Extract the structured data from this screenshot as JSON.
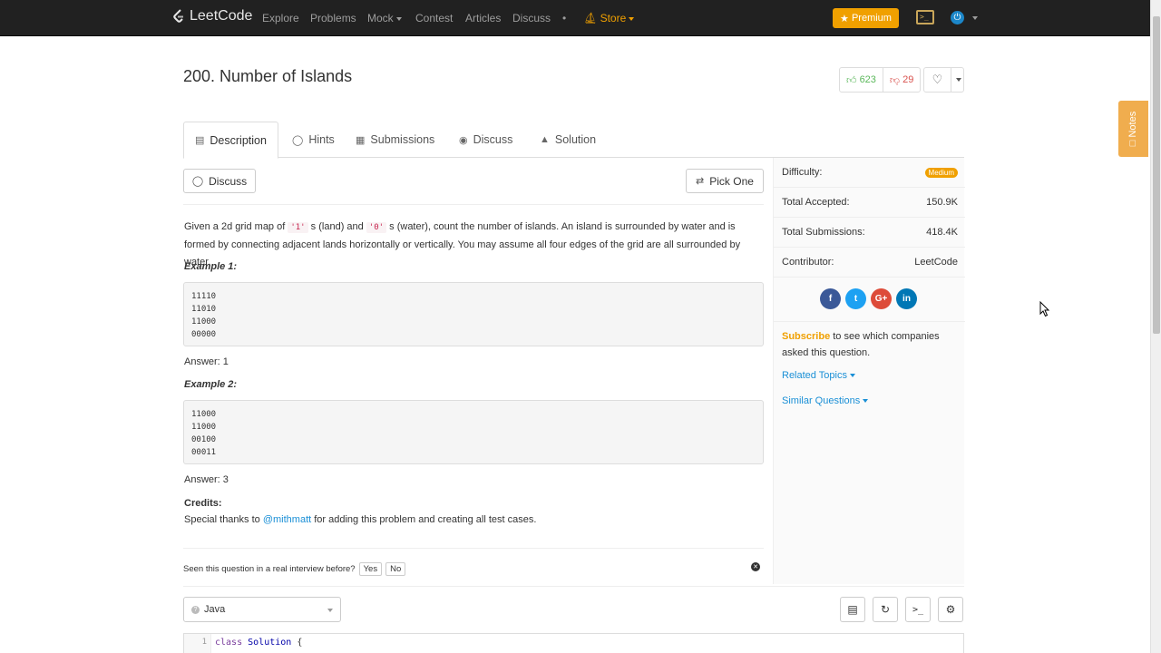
{
  "nav": {
    "logo_text": "LeetCode",
    "links": [
      "Explore",
      "Problems",
      "Mock",
      "Contest",
      "Articles",
      "Discuss"
    ],
    "dot": "•",
    "store": "Store",
    "premium": "Premium",
    "terminal_icon": ">_"
  },
  "problem": {
    "title": "200. Number of Islands",
    "upvotes": "623",
    "downvotes": "29"
  },
  "tabs": [
    "Description",
    "Hints",
    "Submissions",
    "Discuss",
    "Solution"
  ],
  "main": {
    "discuss_btn": "Discuss",
    "pick_one_btn": "Pick One",
    "desc_1": "Given a 2d grid map of ",
    "code_one": "'1'",
    "desc_2": "s (land) and ",
    "code_zero": "'0'",
    "desc_3": "s (water), count the number of islands. An island is surrounded by water and is formed by connecting adjacent lands horizontally or vertically. You may assume all four edges of the grid are all surrounded by water.",
    "example1_title": "Example 1:",
    "example1_grid": "11110\n11010\n11000\n00000",
    "answer1": "Answer: 1",
    "example2_title": "Example 2:",
    "example2_grid": "11000\n11000\n00100\n00011",
    "answer2": "Answer: 3",
    "credits_label": "Credits:",
    "credits_pre": "Special thanks to ",
    "credits_user": "@mithmatt",
    "credits_post": " for adding this problem and creating all test cases.",
    "interview_q": "Seen this question in a real interview before?",
    "yes": "Yes",
    "no": "No"
  },
  "side": {
    "difficulty_label": "Difficulty:",
    "difficulty": "Medium",
    "accepted_label": "Total Accepted:",
    "accepted": "150.9K",
    "submissions_label": "Total Submissions:",
    "submissions": "418.4K",
    "contributor_label": "Contributor:",
    "contributor": "LeetCode",
    "social": [
      "f",
      "t",
      "G+",
      "in"
    ],
    "subscribe": "Subscribe",
    "subscribe_rest": " to see which companies asked this question.",
    "related_topics": "Related Topics",
    "similar_questions": "Similar Questions",
    "notes": "Notes"
  },
  "editor": {
    "language": "Java",
    "line_no": "1",
    "code_kw": "class",
    "code_cls": "Solution",
    "code_brace": " {"
  },
  "colors": {
    "accent": "#f0a000",
    "link": "#1a8fd6",
    "navbar": "#212121"
  }
}
